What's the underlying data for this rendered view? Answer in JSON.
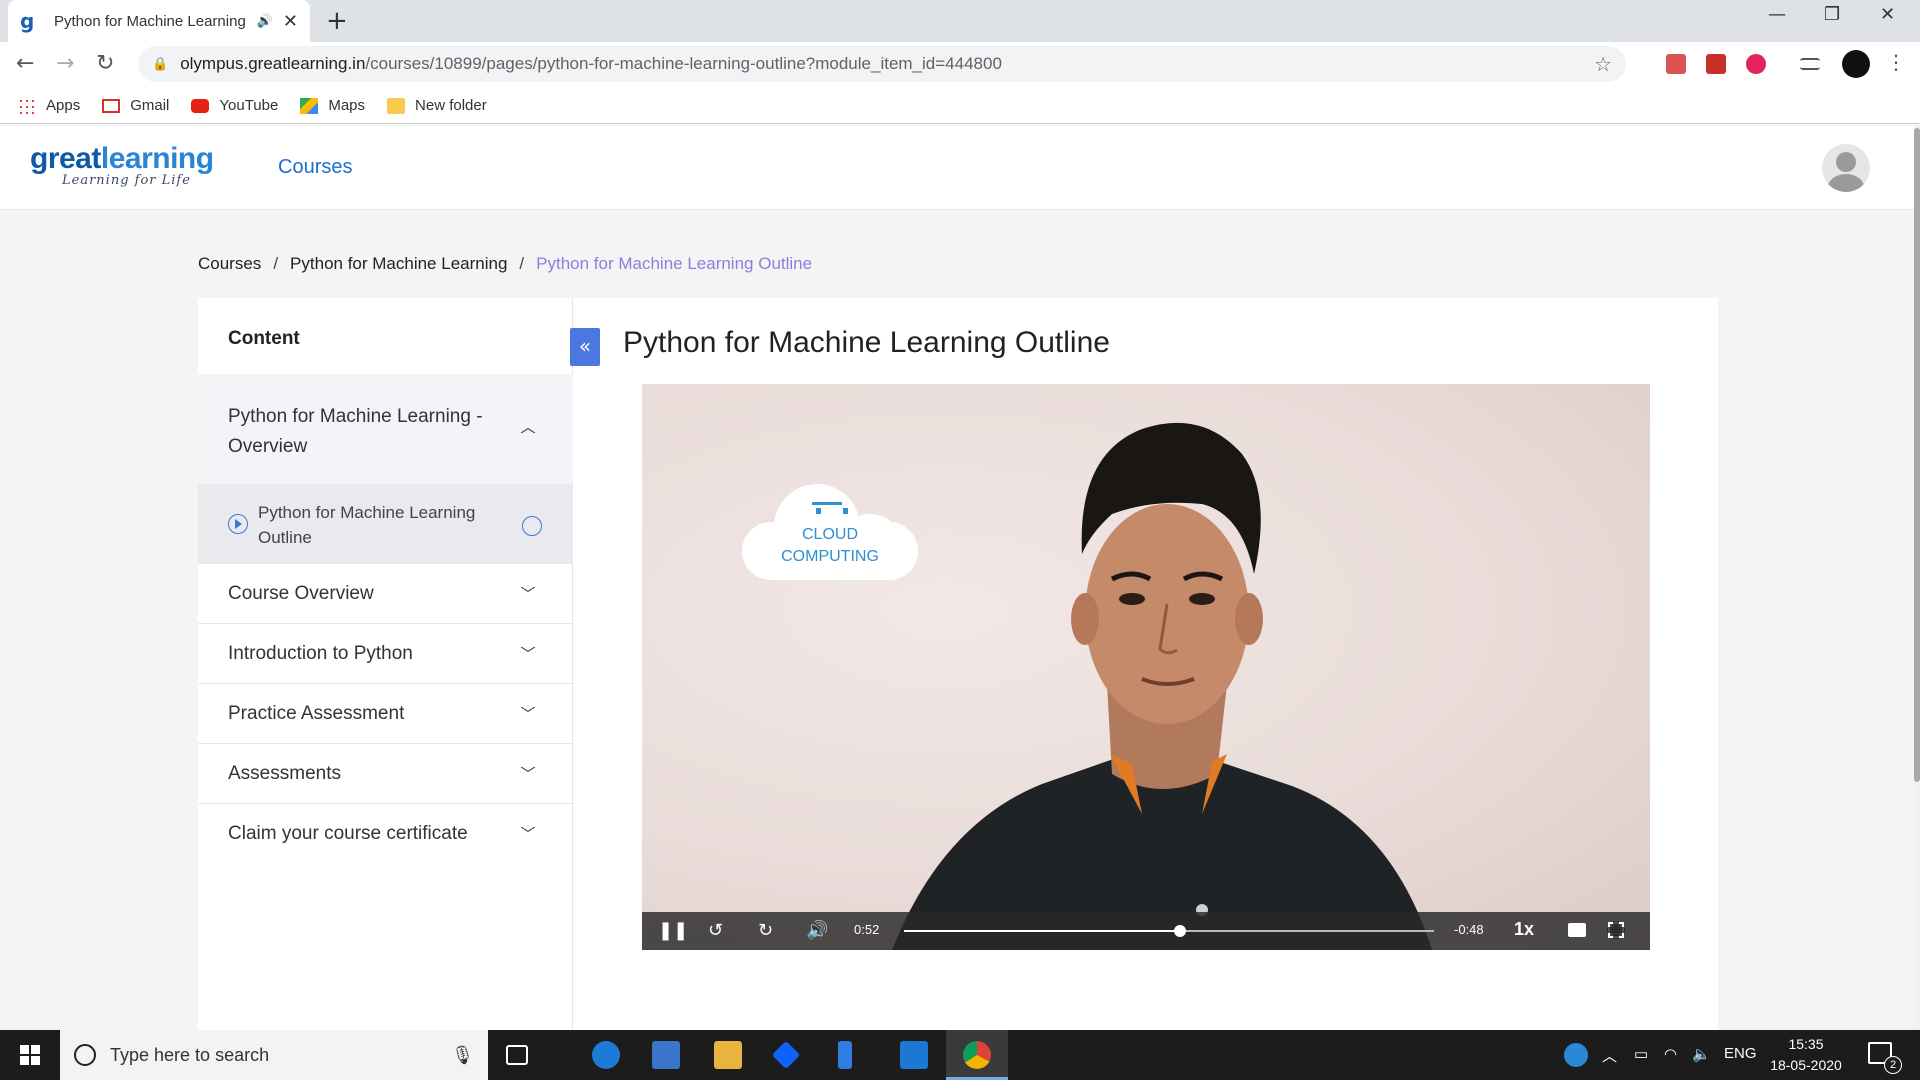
{
  "browser": {
    "tab_title": "Python for Machine Learning",
    "url_host": "olympus.greatlearning.in",
    "url_path": "/courses/10899/pages/python-for-machine-learning-outline?module_item_id=444800",
    "bookmarks": [
      {
        "label": "Apps",
        "icon": "apps-grid-icon"
      },
      {
        "label": "Gmail",
        "icon": "gmail-icon"
      },
      {
        "label": "YouTube",
        "icon": "youtube-icon"
      },
      {
        "label": "Maps",
        "icon": "maps-icon"
      },
      {
        "label": "New folder",
        "icon": "folder-icon"
      }
    ]
  },
  "site": {
    "logo_main": "great",
    "logo_accent": "learning",
    "logo_tagline": "Learning for Life",
    "nav_courses": "Courses"
  },
  "breadcrumb": [
    "Courses",
    "Python for Machine Learning",
    "Python for Machine Learning Outline"
  ],
  "sidebar": {
    "heading": "Content",
    "open_section": "Python for Machine Learning - Overview",
    "active_item": "Python for Machine Learning Outline",
    "sections": [
      "Course Overview",
      "Introduction to Python",
      "Practice Assessment",
      "Assessments",
      "Claim your course certificate"
    ]
  },
  "main": {
    "title": "Python for Machine Learning Outline"
  },
  "video": {
    "overlay_line1": "CLOUD",
    "overlay_line2": "COMPUTING",
    "elapsed": "0:52",
    "remaining": "-0:48",
    "progress_fraction": 0.52,
    "speed": "1x"
  },
  "taskbar": {
    "search_placeholder": "Type here to search",
    "lang": "ENG",
    "time": "15:35",
    "date": "18-05-2020",
    "notification_count": "2"
  },
  "colors": {
    "brand_blue": "#0d5aa7",
    "link_blue": "#1a6fd1",
    "breadcrumb_current": "#8b7fdb",
    "collapse_button": "#4a78e0"
  }
}
